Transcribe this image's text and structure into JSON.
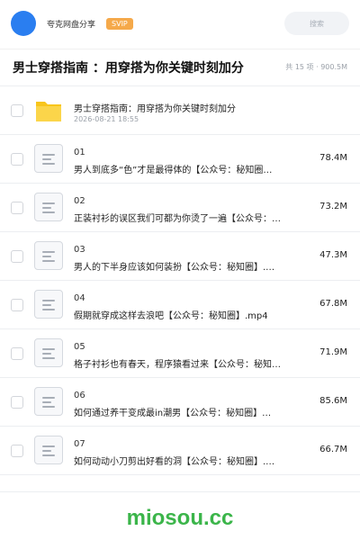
{
  "header": {
    "brand": "夸克网盘分享",
    "vip_badge": "SVIP",
    "search_placeholder": "搜索"
  },
  "share": {
    "title": "男士穿搭指南 ：用穿搭为你关键时刻加分",
    "meta": "共 15 项 · 900.5M"
  },
  "folder": {
    "name": "男士穿搭指南：用穿搭为你关键时刻加分",
    "date": "2026-08-21 18:55"
  },
  "files": [
    {
      "num": "01",
      "name": "男人到底多“色”才是最得体的【公众号：秘知圈…",
      "size": "78.4M"
    },
    {
      "num": "02",
      "name": "正装衬衫的误区我们可都为你烫了一遍【公众号：…",
      "size": "73.2M"
    },
    {
      "num": "03",
      "name": "男人的下半身应该如何装扮【公众号：秘知圈】.…",
      "size": "47.3M"
    },
    {
      "num": "04",
      "name": "假期就穿成这样去浪吧【公众号：秘知圈】.mp4",
      "size": "67.8M"
    },
    {
      "num": "05",
      "name": "格子衬衫也有春天，程序猿看过来【公众号：秘知…",
      "size": "71.9M"
    },
    {
      "num": "06",
      "name": "如何通过养干变成最in潮男【公众号：秘知圈】…",
      "size": "85.6M"
    },
    {
      "num": "07",
      "name": "如何动动小刀剪出好看的洞【公众号：秘知圈】.…",
      "size": "66.7M"
    }
  ],
  "footer": {
    "watermark": "miosou.cc"
  },
  "colors": {
    "avatar": "#2a7ef0",
    "vip": "#f5a94a",
    "folder": "#f8c51c",
    "watermark": "#3bb54a"
  }
}
